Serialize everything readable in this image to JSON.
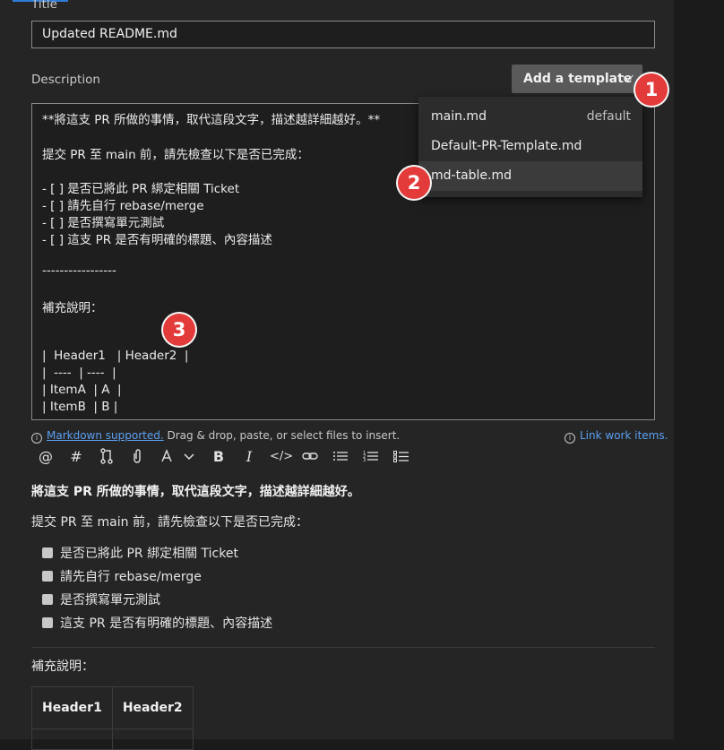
{
  "form": {
    "title_label": "Title",
    "title_value": "Updated README.md",
    "description_label": "Description",
    "add_template_label": "Add a template",
    "description_lines": [
      "**將這支 PR 所做的事情，取代這段文字，描述越詳細越好。**",
      "",
      "提交 PR 至 main 前，請先檢查以下是否已完成：",
      "",
      "- [ ] 是否已將此 PR 綁定相關 Ticket",
      "- [ ] 請先自行 rebase/merge",
      "- [ ] 是否撰寫單元測試",
      "- [ ] 這支 PR 是否有明確的標題、內容描述",
      "",
      "-----------------",
      "",
      "補充說明：",
      "",
      "",
      "|  Header1   | Header2  |",
      "|  ----  | ----  |",
      "| ItemA  | A  |",
      "| ItemB  | B |"
    ]
  },
  "dropdown": {
    "items": [
      {
        "label": "main.md",
        "tag": "default"
      },
      {
        "label": "Default-PR-Template.md",
        "tag": ""
      },
      {
        "label": "md-table.md",
        "tag": ""
      }
    ]
  },
  "badges": [
    "1",
    "2",
    "3"
  ],
  "hints": {
    "markdown_link": "Markdown supported.",
    "markdown_rest": " Drag & drop, paste, or select files to insert.",
    "link_work_items": "Link work items."
  },
  "toolbar": {
    "icons": [
      "mention-icon",
      "hashtag-icon",
      "pull-request-icon",
      "attachment-icon",
      "highlight-icon",
      "chevron-down-icon",
      "bold-icon",
      "italic-icon",
      "code-icon",
      "link-icon",
      "bulleted-list-icon",
      "numbered-list-icon",
      "checklist-icon"
    ]
  },
  "preview": {
    "bold_line": "將這支 PR 所做的事情，取代這段文字，描述越詳細越好。",
    "intro": "提交 PR 至 main 前，請先檢查以下是否已完成：",
    "checklist": [
      "是否已將此 PR 綁定相關 Ticket",
      "請先自行 rebase/merge",
      "是否撰寫單元測試",
      "這支 PR 是否有明確的標題、內容描述"
    ],
    "supplement": "補充說明：",
    "table_headers": [
      "Header1",
      "Header2"
    ]
  },
  "colors": {
    "badge": "#e33a3a",
    "link": "#5aa0f0",
    "accent": "#2f7bd6"
  }
}
